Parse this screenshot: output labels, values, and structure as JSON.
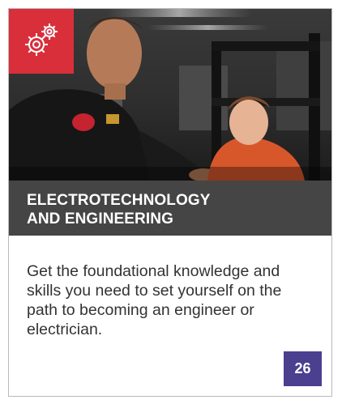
{
  "card": {
    "title_lines": [
      "ELECTROTECHNOLOGY",
      "AND ENGINEERING"
    ],
    "description": "Get the foundational knowledge and skills you need to set yourself on the path to becoming an engineer or electrician.",
    "page_number": "26"
  },
  "icon": {
    "name": "gears-icon",
    "tile_color": "#d92f3b"
  },
  "colors": {
    "title_band": "#454545",
    "page_badge": "#4b3f8f",
    "body_text": "#333333"
  }
}
